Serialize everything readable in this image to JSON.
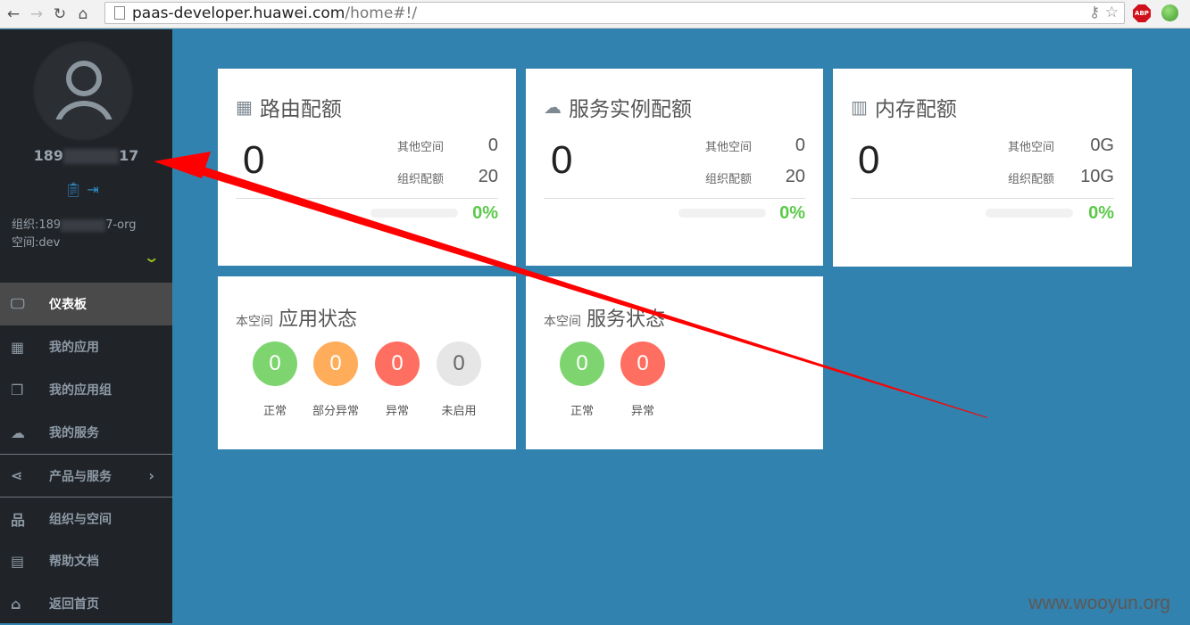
{
  "browser": {
    "url_host": "paas-developer.huawei.com",
    "url_path": "/home#!/",
    "abp": "ABP"
  },
  "user": {
    "name_prefix": "189",
    "name_suffix": "17",
    "org_prefix": "组织:189",
    "org_suffix": "7-org",
    "space": "空间:dev"
  },
  "menu": [
    {
      "label": "仪表板",
      "icon": "monitor-icon"
    },
    {
      "label": "我的应用",
      "icon": "grid-icon"
    },
    {
      "label": "我的应用组",
      "icon": "windows-icon"
    },
    {
      "label": "我的服务",
      "icon": "cloud-icon"
    },
    {
      "label": "产品与服务",
      "icon": "share-icon"
    },
    {
      "label": "组织与空间",
      "icon": "sitemap-icon"
    },
    {
      "label": "帮助文档",
      "icon": "document-icon"
    },
    {
      "label": "返回首页",
      "icon": "home-icon"
    }
  ],
  "quotas": [
    {
      "title": "路由配额",
      "icon": "grid-icon",
      "used": "0",
      "other_label": "其他空间",
      "other": "0",
      "org_label": "组织配额",
      "org": "20",
      "percent": "0%"
    },
    {
      "title": "服务实例配额",
      "icon": "cloud-icon",
      "used": "0",
      "other_label": "其他空间",
      "other": "0",
      "org_label": "组织配额",
      "org": "20",
      "percent": "0%"
    },
    {
      "title": "内存配额",
      "icon": "memory-icon",
      "used": "0",
      "other_label": "其他空间",
      "other": "0G",
      "org_label": "组织配额",
      "org": "10G",
      "percent": "0%"
    }
  ],
  "app_status": {
    "scope": "本空间",
    "title": "应用状态",
    "items": [
      {
        "label": "正常",
        "value": "0",
        "color": "#7ed56f"
      },
      {
        "label": "部分异常",
        "value": "0",
        "color": "#ffad5a"
      },
      {
        "label": "异常",
        "value": "0",
        "color": "#ff6f61"
      },
      {
        "label": "未启用",
        "value": "0",
        "color": "#e6e6e6"
      }
    ]
  },
  "service_status": {
    "scope": "本空间",
    "title": "服务状态",
    "items": [
      {
        "label": "正常",
        "value": "0",
        "color": "#7ed56f"
      },
      {
        "label": "异常",
        "value": "0",
        "color": "#ff6f61"
      }
    ]
  },
  "watermark": "www.wooyun.org"
}
